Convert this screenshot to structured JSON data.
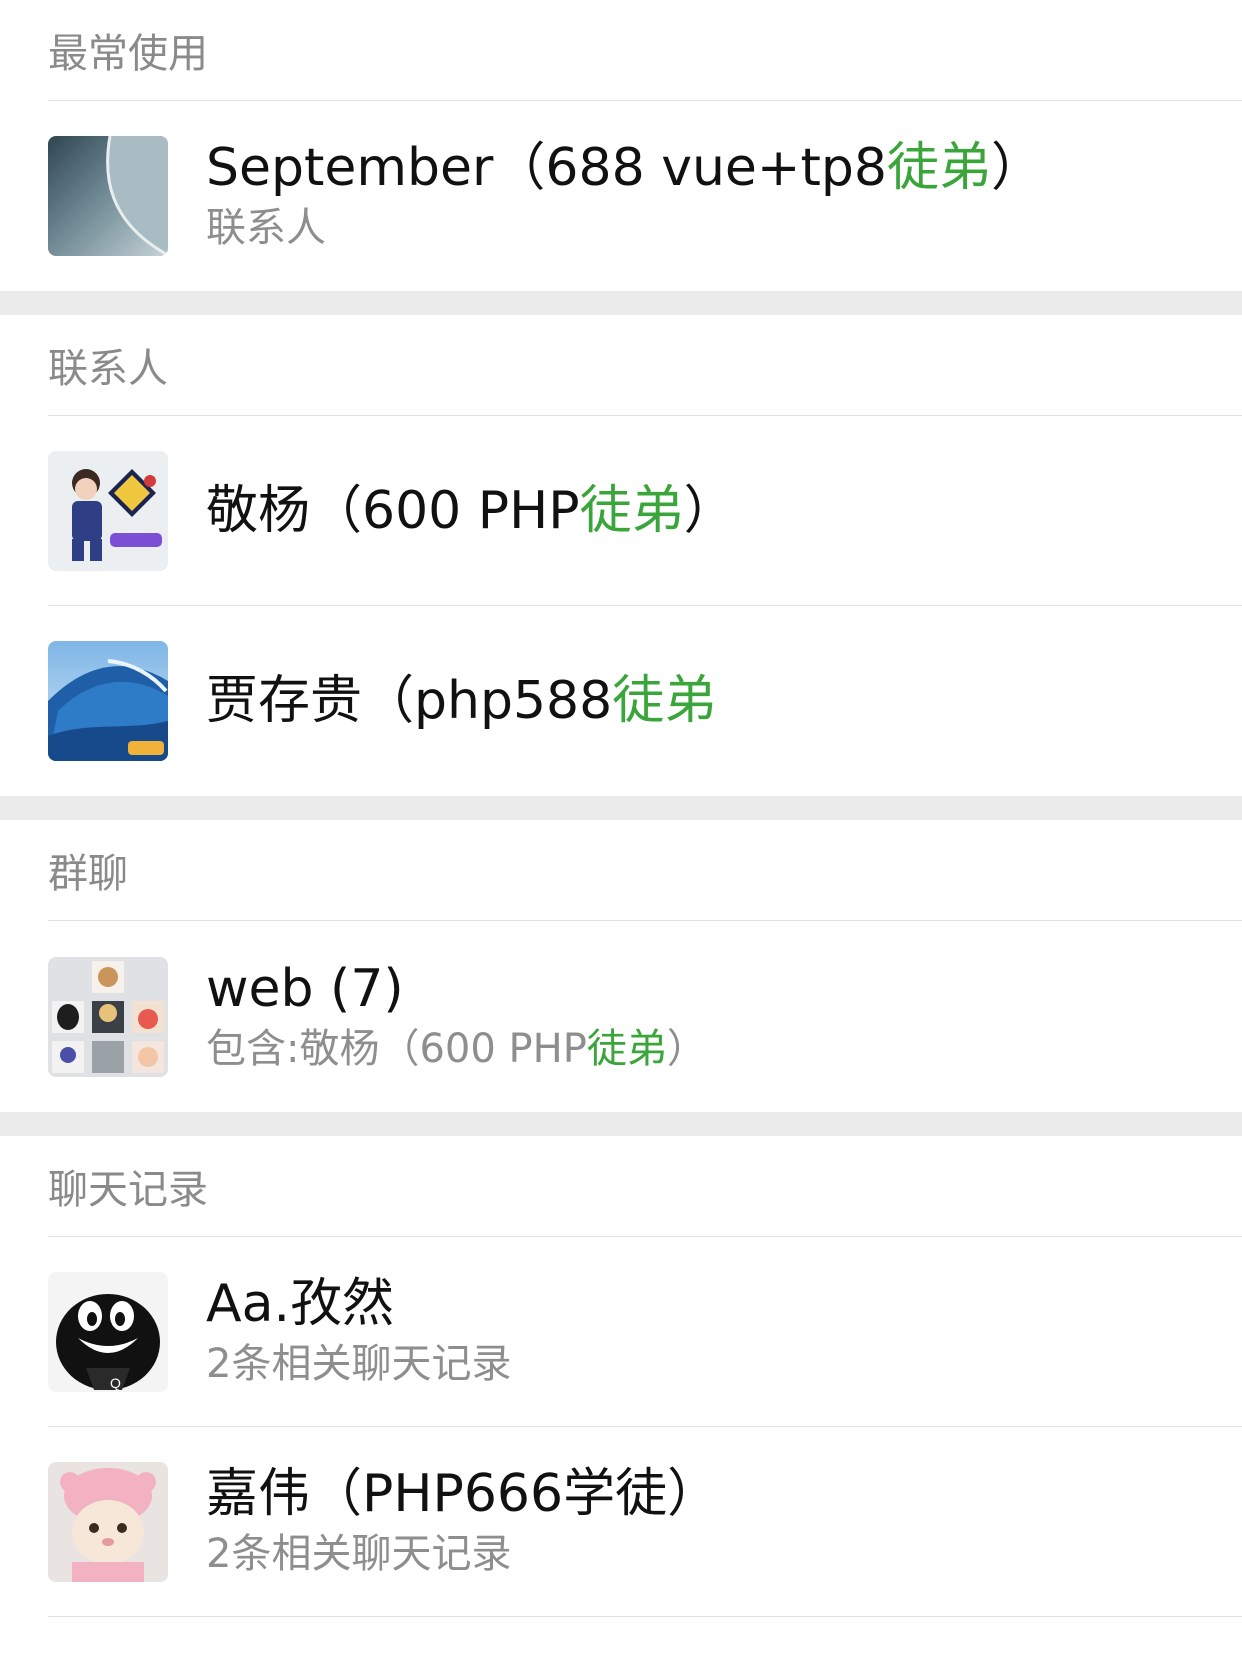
{
  "sections": {
    "frequent": {
      "header": "最常使用",
      "items": [
        {
          "title_pre": "September（688 vue+tp8",
          "title_hl": "徒弟",
          "title_post": "）",
          "subtitle": "联系人",
          "avatar_icon": "curved-metal-avatar"
        }
      ]
    },
    "contacts": {
      "header": "联系人",
      "items": [
        {
          "title_pre": "敬杨（600 PHP",
          "title_hl": "徒弟",
          "title_post": "）",
          "avatar_icon": "child-cartoon-avatar"
        },
        {
          "title_pre": "贾存贵（php588",
          "title_hl": "徒弟",
          "title_post": "",
          "avatar_icon": "ocean-wave-avatar"
        }
      ]
    },
    "groups": {
      "header": "群聊",
      "items": [
        {
          "title": "web (7)",
          "subtitle_pre": "包含:敬杨（600 PHP",
          "subtitle_hl": "徒弟",
          "subtitle_post": "）",
          "avatar_icon": "group-grid-avatar"
        }
      ]
    },
    "chat_history": {
      "header": "聊天记录",
      "items": [
        {
          "title": "Aa.孜然",
          "subtitle": "2条相关聊天记录",
          "avatar_icon": "qq-penguin-avatar"
        },
        {
          "title": "嘉伟（PHP666学徒）",
          "subtitle": "2条相关聊天记录",
          "avatar_icon": "pig-hat-cat-avatar"
        }
      ]
    }
  },
  "colors": {
    "highlight": "#3aa53a",
    "header_text": "#8a8a8a",
    "gap": "#ebebeb"
  }
}
